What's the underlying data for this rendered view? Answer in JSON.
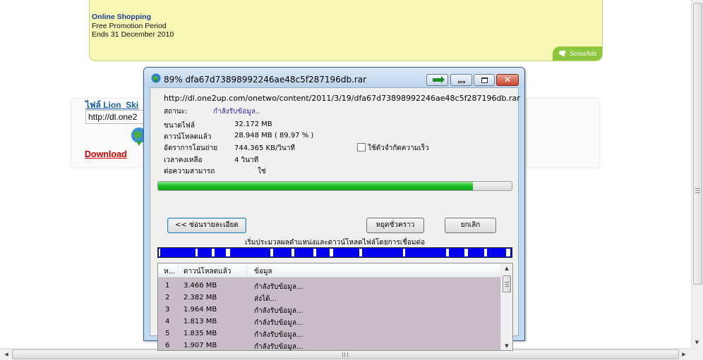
{
  "ad": {
    "title": "Online Shopping",
    "line1": "Free Promotion Period",
    "line2": "Ends 31 December 2010",
    "brand": "ScoutAds"
  },
  "page": {
    "file_title": "ไฟล์ Lion_Ski",
    "url_value": "http://dl.one2",
    "download_link": "Download"
  },
  "dialog": {
    "title": "89% dfa67d73898992246ae48c5f287196db.rar",
    "url": "http://dl.one2up.com/onetwo/content/2011/3/19/dfa67d73898992246ae48c5f287196db.rar",
    "status_label": "สถานะ:",
    "status_value": "กำลังรับข้อมูล..",
    "file_size_label": "ขนาดไฟล์",
    "file_size_value": "32.172  MB",
    "downloaded_label": "ดาวน์โหลดแล้ว",
    "downloaded_value": "28.948  MB  ( 89.97 % )",
    "rate_label": "อัตราการโอนถ่าย",
    "rate_value": "744.365  KB/วินาที",
    "remaining_label": "เวลาคงเหลือ",
    "remaining_value": "4 วินาที",
    "resume_label": "ต่อความสามารถ",
    "resume_value": "ใช่",
    "speed_limiter_label": "ใช้ตัวจำกัดความเร็ว",
    "progress_percent": 89.97,
    "buttons": {
      "hide_details": "<< ซ่อนรายละเอียด",
      "pause": "หยุดชั่วคราว",
      "cancel": "ยกเลิก"
    },
    "segments_label": "เริ่มประมวลผลตำแหน่งและดาวน์โหลดไฟล์โดยการเชื่อมต่อ",
    "connections": {
      "columns": [
        "ห...",
        "ดาวน์โหลดแล้ว",
        "ข้อมูล"
      ],
      "rows": [
        {
          "n": "1",
          "downloaded": "3.466  MB",
          "info": "กำลังรับข้อมูล..."
        },
        {
          "n": "2",
          "downloaded": "2.382  MB",
          "info": "ส่งได้..."
        },
        {
          "n": "3",
          "downloaded": "1.964  MB",
          "info": "กำลังรับข้อมูล..."
        },
        {
          "n": "4",
          "downloaded": "1.813  MB",
          "info": "กำลังรับข้อมูล..."
        },
        {
          "n": "5",
          "downloaded": "1.835  MB",
          "info": "กำลังรับข้อมูล..."
        },
        {
          "n": "6",
          "downloaded": "1.907  MB",
          "info": "กำลังรับข้อมูล..."
        }
      ]
    }
  },
  "colors": {
    "progress_green": "#1fbf24",
    "segment_blue": "#0000ee",
    "status_blue": "#2a2ab8",
    "download_link_red": "#d40000",
    "list_background": "#c7bcc7"
  }
}
